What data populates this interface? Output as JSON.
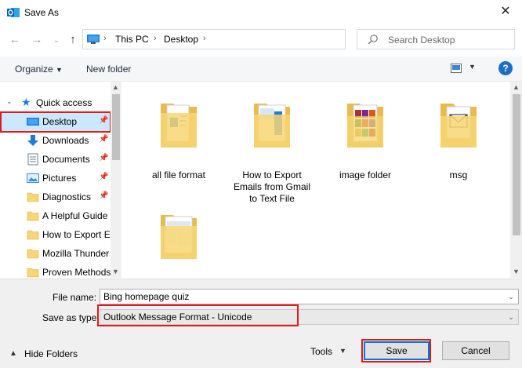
{
  "window": {
    "title": "Save As"
  },
  "address": {
    "crumbs": [
      "This PC",
      "Desktop"
    ]
  },
  "search": {
    "placeholder": "Search Desktop"
  },
  "toolbar": {
    "organize": "Organize",
    "new_folder": "New folder"
  },
  "nav": {
    "quick_access": "Quick access",
    "items": [
      {
        "label": "Desktop",
        "pinned": true,
        "selected": true,
        "icon": "desktop-icon"
      },
      {
        "label": "Downloads",
        "pinned": true,
        "icon": "download-arrow-icon"
      },
      {
        "label": "Documents",
        "pinned": true,
        "icon": "document-icon"
      },
      {
        "label": "Pictures",
        "pinned": true,
        "icon": "pictures-icon"
      },
      {
        "label": "Diagnostics",
        "pinned": true,
        "icon": "folder-icon"
      },
      {
        "label": "A Helpful Guide",
        "icon": "folder-icon"
      },
      {
        "label": "How to Export E",
        "icon": "folder-icon"
      },
      {
        "label": "Mozilla Thunder",
        "icon": "folder-icon"
      },
      {
        "label": "Proven Methods",
        "icon": "folder-icon"
      }
    ]
  },
  "files": [
    {
      "name": "all file format"
    },
    {
      "name": "How to Export Emails from Gmail to Text File"
    },
    {
      "name": "image folder"
    },
    {
      "name": "msg"
    },
    {
      "name": ""
    }
  ],
  "form": {
    "file_name_label": "File name:",
    "file_name_value": "Bing homepage quiz",
    "save_type_label": "Save as type:",
    "save_type_value": "Outlook Message Format - Unicode"
  },
  "footer": {
    "hide_folders": "Hide Folders",
    "tools": "Tools",
    "save": "Save",
    "cancel": "Cancel"
  },
  "colors": {
    "accent": "#0078d7",
    "selection": "#cce8ff",
    "highlight_box": "#e01b1b",
    "folder": "#f7d673"
  }
}
